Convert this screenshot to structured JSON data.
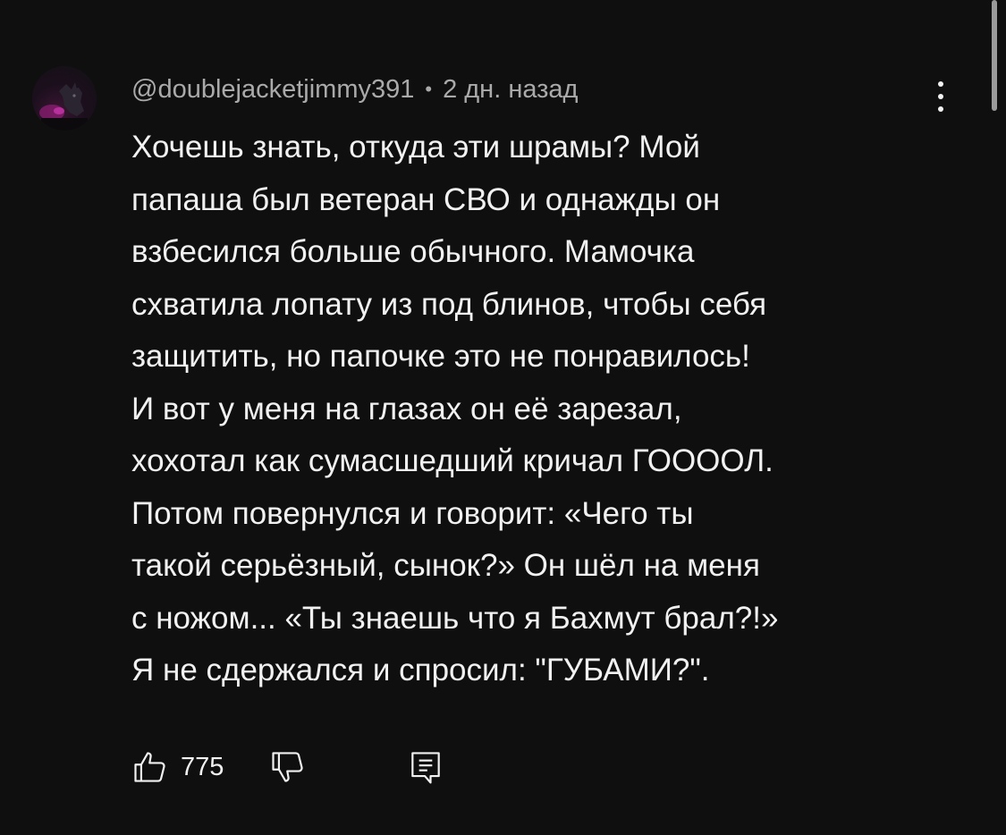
{
  "comment": {
    "author": "@doublejacketjimmy391",
    "separator": "•",
    "timestamp": "2 дн. назад",
    "text_lines": [
      "Хочешь знать, откуда эти шрамы? Мой",
      "папаша был ветеран СВО и однажды он",
      "взбесился больше обычного. Мамочка",
      "схватила лопату из под блинов, чтобы себя",
      "защитить, но папочке это не понравилось!",
      "И вот у меня на глазах он её зарезал,",
      "хохотал как сумасшедший кричал ГООООЛ.",
      "Потом повернулся и говорит: «Чего ты",
      "такой серьёзный, сынок?» Он шёл на меня",
      "с ножом... «Ты знаешь что я Бахмут брал?!»",
      "Я не сдержался и спросил: \"ГУБАМИ?\"."
    ],
    "like_count": "775"
  },
  "icons": {
    "avatar": "avatar-image",
    "menu": "more-vertical-icon",
    "like": "thumbs-up-icon",
    "dislike": "thumbs-down-icon",
    "reply": "reply-comment-icon"
  },
  "colors": {
    "background": "#0f0f0f",
    "text_primary": "#f1f1f1",
    "text_secondary": "#aaaaaa"
  }
}
